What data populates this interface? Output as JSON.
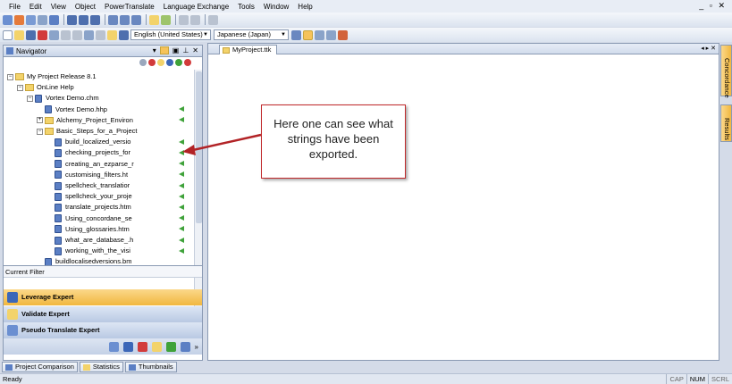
{
  "menu": [
    "File",
    "Edit",
    "View",
    "Object",
    "PowerTranslate",
    "Language Exchange",
    "Tools",
    "Window",
    "Help"
  ],
  "window_controls": "_ ▫ ✕",
  "toolbar2": {
    "source_lang": "English (United States)",
    "target_lang": "Japanese (Japan)"
  },
  "navigator": {
    "title": "Navigator",
    "tree": [
      {
        "label": "My Project Release 8.1",
        "level": 0,
        "kind": "root",
        "exp": "−"
      },
      {
        "label": "OnLine Help",
        "level": 1,
        "kind": "folder",
        "exp": "−"
      },
      {
        "label": "Vortex Demo.chm",
        "level": 2,
        "kind": "chm",
        "exp": "−"
      },
      {
        "label": "Vortex Demo.hhp",
        "level": 3,
        "kind": "hhp",
        "exp": "",
        "exported": true
      },
      {
        "label": "Alchemy_Project_Environ",
        "level": 3,
        "kind": "folder",
        "exp": "+",
        "exported": true
      },
      {
        "label": "Basic_Steps_for_a_Project",
        "level": 3,
        "kind": "folder",
        "exp": "−"
      },
      {
        "label": "build_localized_versio",
        "level": 4,
        "kind": "file",
        "exp": "",
        "exported": true
      },
      {
        "label": "checking_projects_for",
        "level": 4,
        "kind": "file",
        "exp": "",
        "exported": true
      },
      {
        "label": "creating_an_ezparse_r",
        "level": 4,
        "kind": "file",
        "exp": "",
        "exported": true
      },
      {
        "label": "customising_filters.ht",
        "level": 4,
        "kind": "file",
        "exp": "",
        "exported": true
      },
      {
        "label": "spellcheck_translatior",
        "level": 4,
        "kind": "file",
        "exp": "",
        "exported": true
      },
      {
        "label": "spellcheck_your_proje",
        "level": 4,
        "kind": "file",
        "exp": "",
        "exported": true
      },
      {
        "label": "translate_projects.htm",
        "level": 4,
        "kind": "file",
        "exp": "",
        "exported": true
      },
      {
        "label": "Using_concordane_se",
        "level": 4,
        "kind": "file",
        "exp": "",
        "exported": true
      },
      {
        "label": "Using_glossaries.htm",
        "level": 4,
        "kind": "file",
        "exp": "",
        "exported": true
      },
      {
        "label": "what_are_database_.h",
        "level": 4,
        "kind": "file",
        "exp": "",
        "exported": true
      },
      {
        "label": "working_with_the_visi",
        "level": 4,
        "kind": "file",
        "exp": "",
        "exported": true
      },
      {
        "label": "buildlocalisedversions.bm",
        "level": 3,
        "kind": "file",
        "exp": "",
        "exported": false
      }
    ],
    "filter_label": "Current Filter",
    "experts": [
      "Leverage Expert",
      "Validate Expert",
      "Pseudo Translate Expert"
    ]
  },
  "document": {
    "tab": "MyProject.ttk"
  },
  "side_tabs": [
    "Concordance",
    "Results"
  ],
  "callout": "Here one can see what strings have been exported.",
  "bottom_tabs": [
    "Project Comparison",
    "Statistics",
    "Thumbnails"
  ],
  "status": {
    "text": "Ready",
    "indicators": [
      "CAP",
      "NUM",
      "SCRL"
    ]
  },
  "colors": {
    "accent_orange": "#f6c35a",
    "expert_blue": "#3c67b8",
    "callout_red": "#c0282a",
    "export_green": "#3fa23a"
  }
}
